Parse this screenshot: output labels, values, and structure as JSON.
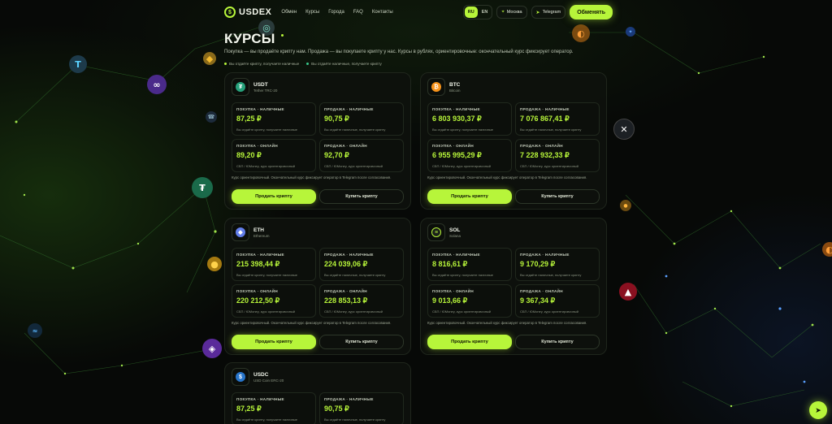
{
  "header": {
    "logo_text": "USDEX",
    "nav": [
      "Обмен",
      "Курсы",
      "Города",
      "FAQ",
      "Контакты"
    ],
    "lang": [
      "RU",
      "EN"
    ],
    "city": "Москва",
    "telegram": "Telegram",
    "cta": "Обменять"
  },
  "page": {
    "title": "КУРСЫ",
    "subtitle": "Покупка — вы продаёте крипту нам. Продажа — вы покупаете крипту у нас. Курсы в рублях, ориентировочные: окончательный курс фиксирует оператор.",
    "legend_sell": "Вы отдаёте крипту, получаете наличные",
    "legend_buy": "Вы отдаёте наличные, получаете крипту"
  },
  "labels": {
    "buy_cash": "ПОКУПКА · НАЛИЧНЫЕ",
    "sell_cash": "ПРОДАЖА · НАЛИЧНЫЕ",
    "buy_online": "ПОКУПКА · ОНЛАЙН",
    "sell_online": "ПРОДАЖА · ОНЛАЙН",
    "note_buy_cash": "Вы отдаёте крипту, получаете наличные",
    "note_sell_cash": "Вы отдаёте наличные, получаете крипту",
    "note_online": "СБП / ЮMoney, курс ориентировочный",
    "disclaimer": "Курс ориентировочный. Окончательный курс фиксирует оператор в Telegram после согласования.",
    "sell_btn": "Продать крипту",
    "buy_btn": "Купить крипту"
  },
  "cards": [
    {
      "symbol": "USDT",
      "network": "Tether TRC-20",
      "icon": "tether-icon",
      "color": "#26a17b",
      "buy_cash": "87,25 ₽",
      "sell_cash": "90,75 ₽",
      "buy_online": "89,20 ₽",
      "sell_online": "92,70 ₽"
    },
    {
      "symbol": "BTC",
      "network": "Bitcoin",
      "icon": "bitcoin-icon",
      "color": "#f7931a",
      "buy_cash": "6 803 930,37 ₽",
      "sell_cash": "7 076 867,41 ₽",
      "buy_online": "6 955 995,29 ₽",
      "sell_online": "7 228 932,33 ₽"
    },
    {
      "symbol": "ETH",
      "network": "Ethereum",
      "icon": "ethereum-icon",
      "color": "#627eea",
      "buy_cash": "215 398,44 ₽",
      "sell_cash": "224 039,06 ₽",
      "buy_online": "220 212,50 ₽",
      "sell_online": "228 853,13 ₽"
    },
    {
      "symbol": "SOL",
      "network": "Solana",
      "icon": "solana-icon",
      "color": "#1a1f1a",
      "buy_cash": "8 816,61 ₽",
      "sell_cash": "9 170,29 ₽",
      "buy_online": "9 013,66 ₽",
      "sell_online": "9 367,34 ₽"
    },
    {
      "symbol": "USDC",
      "network": "USD Coin ERC-20",
      "icon": "usdc-icon",
      "color": "#2775ca",
      "buy_cash": "87,25 ₽",
      "sell_cash": "90,75 ₽",
      "buy_online": "",
      "sell_online": ""
    }
  ],
  "colors": {
    "accent": "#b7f53a",
    "background": "#070907",
    "card": "#0e110d"
  }
}
